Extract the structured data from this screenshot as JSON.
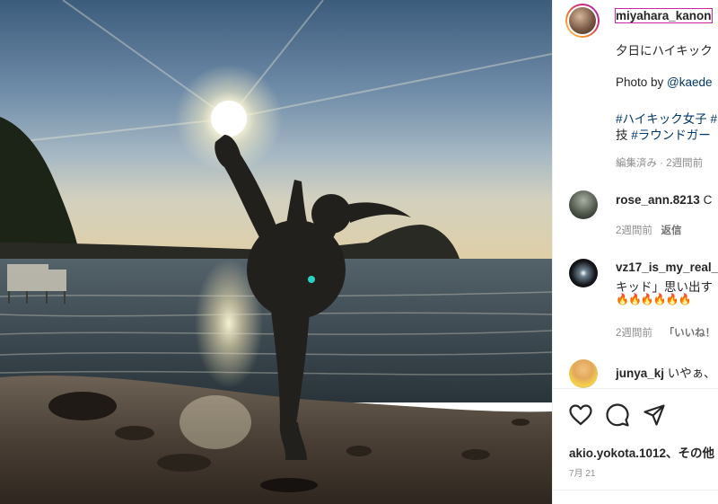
{
  "photo": {
    "alt": ""
  },
  "post": {
    "author": "miyahara_kanon",
    "caption_line1": "夕日にハイキック",
    "photo_credit_prefix": "Photo by ",
    "photo_credit_handle": "@kaede",
    "hashtags_line1": "#ハイキック女子 #",
    "hashtags_line2_prefix": "技 ",
    "hashtags_line2_tag": "#ラウンドガー",
    "meta": "編集済み · 2週間前"
  },
  "comments": [
    {
      "user": "rose_ann.8213",
      "text": "C",
      "time": "2週間前",
      "reply": "返信"
    },
    {
      "user": "vz17_is_my_real_",
      "text_line2": "キッド」思い出す",
      "emoji": "🔥🔥🔥🔥🔥🔥",
      "time": "2週間前",
      "likes": "「いいね！"
    },
    {
      "user": "junya_kj",
      "text": "いやぁ、"
    }
  ],
  "actions": {
    "like_icon": "heart-icon",
    "comment_icon": "comment-icon",
    "share_icon": "share-icon"
  },
  "likes_line": "akio.yokota.1012、その他",
  "date": "7月 21",
  "colors": {
    "username": "#262626",
    "link": "#00376b",
    "muted": "#8e8e8e",
    "story_ring": "#d6249f"
  }
}
